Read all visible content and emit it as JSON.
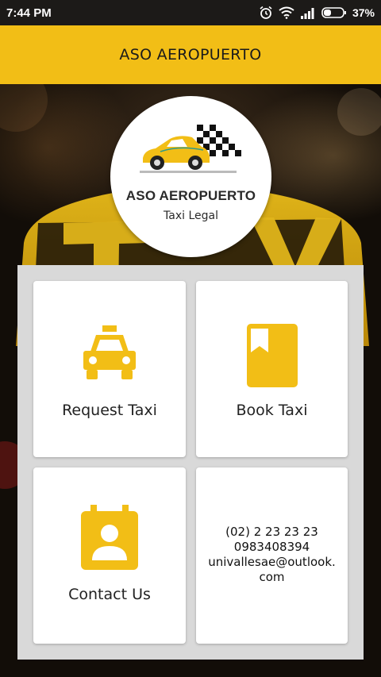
{
  "status_bar": {
    "time": "7:44 PM",
    "battery": "37%",
    "icons": [
      "alarm-icon",
      "wifi-icon",
      "signal-icon",
      "battery-icon"
    ]
  },
  "app_bar": {
    "title": "ASO AEROPUERTO"
  },
  "logo": {
    "name": "ASO AEROPUERTO",
    "tagline": "Taxi Legal",
    "icon": "taxi-car-logo"
  },
  "menu": {
    "request_taxi": {
      "label": "Request Taxi",
      "icon": "taxi-front-icon"
    },
    "book_taxi": {
      "label": "Book Taxi",
      "icon": "bookmark-book-icon"
    },
    "contact_us": {
      "label": "Contact Us",
      "icon": "contact-card-icon"
    },
    "contact_info": {
      "phone": "(02) 2 23 23 23",
      "mobile": "0983408394",
      "email_line1": "univallesae@outlook.",
      "email_line2": "com"
    }
  },
  "colors": {
    "accent": "#f2be16",
    "icon": "#f2be16",
    "panel": "#d9d9d9",
    "card": "#ffffff"
  }
}
